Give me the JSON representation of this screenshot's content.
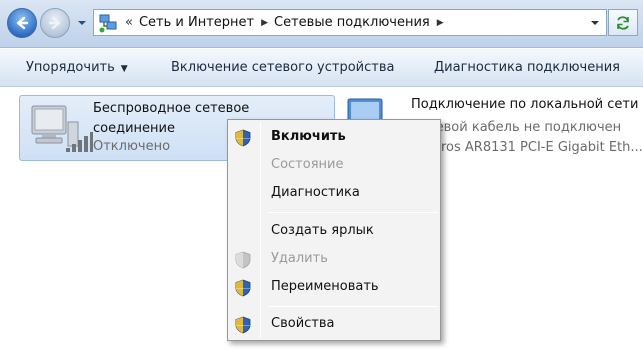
{
  "address": {
    "overflow_chevron": "«",
    "crumbs": [
      "Сеть и Интернет",
      "Сетевые подключения"
    ]
  },
  "toolbar": {
    "organize_label": "Упорядочить",
    "enable_device_label": "Включение сетевого устройства",
    "diagnose_label": "Диагностика подключения"
  },
  "connections": {
    "wireless": {
      "name": "Беспроводное сетевое соединение",
      "status": "Отключено"
    },
    "lan": {
      "title": "Подключение по локальной сети",
      "line2": "Сетевой кабель не подключен",
      "line3": "Atheros AR8131 PCI-E Gigabit Eth..."
    }
  },
  "context_menu": {
    "enable": "Включить",
    "status": "Состояние",
    "diagnostics": "Диагностика",
    "create_shortcut": "Создать ярлык",
    "delete": "Удалить",
    "rename": "Переименовать",
    "properties": "Свойства"
  },
  "colors": {
    "accent": "#2e6fc4",
    "selection": "#cfe0f5",
    "menu_bg": "#f3f3f3"
  }
}
